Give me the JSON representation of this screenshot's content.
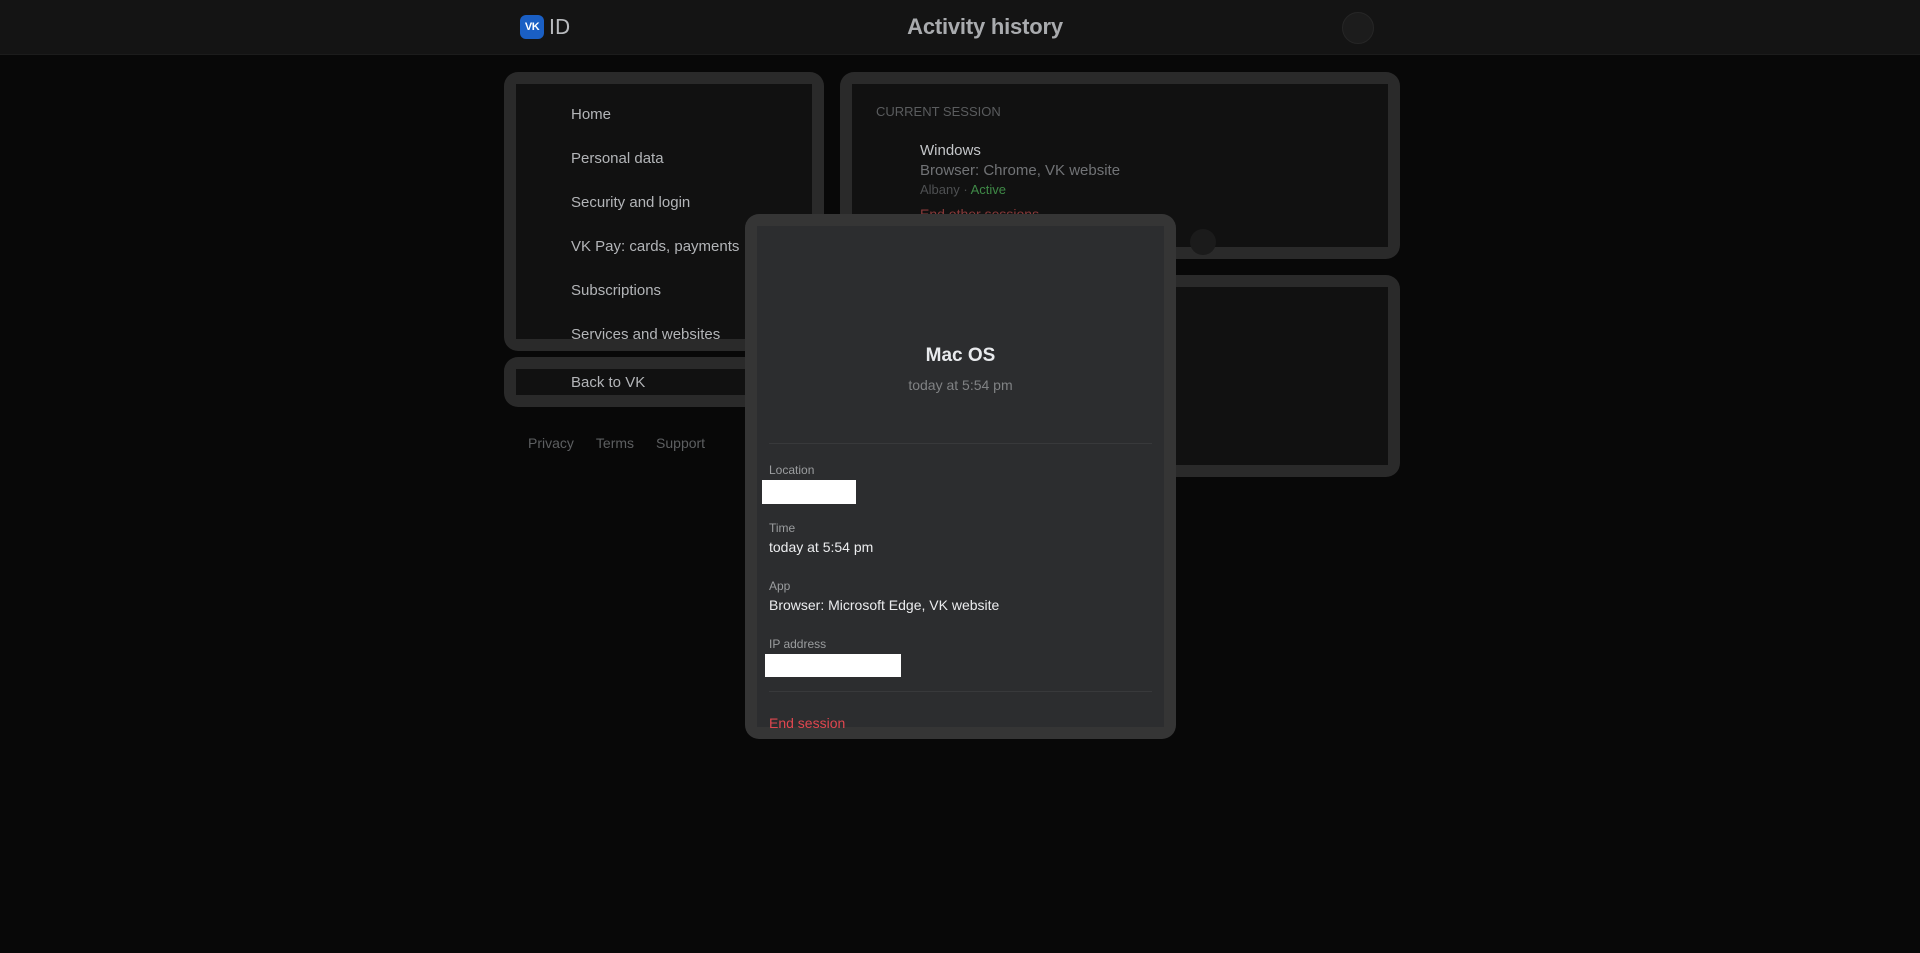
{
  "header": {
    "logo_mark": "VK",
    "logo_text": "ID",
    "title": "Activity history"
  },
  "sidebar": {
    "items": [
      {
        "label": "Home"
      },
      {
        "label": "Personal data"
      },
      {
        "label": "Security and login"
      },
      {
        "label": "VK Pay: cards, payments"
      },
      {
        "label": "Subscriptions"
      },
      {
        "label": "Services and websites"
      }
    ],
    "back_label": "Back to VK"
  },
  "footer": {
    "links": [
      "Privacy",
      "Terms",
      "Support"
    ]
  },
  "current_session": {
    "caption": "CURRENT SESSION",
    "device": "Windows",
    "app": "Browser: Chrome, VK website",
    "location": "Albany",
    "separator": "·",
    "status": "Active",
    "end_other": "End other sessions"
  },
  "modal": {
    "title": "Mac OS",
    "subtitle": "today at 5:54 pm",
    "location_label": "Location",
    "time_label": "Time",
    "time_value": "today at 5:54 pm",
    "app_label": "App",
    "app_value": "Browser: Microsoft Edge, VK website",
    "ip_label": "IP address",
    "end_session": "End session"
  },
  "colors": {
    "accent_blue": "#1a5fc4",
    "active_green": "#3f8a47",
    "danger_red": "#e0474f"
  }
}
